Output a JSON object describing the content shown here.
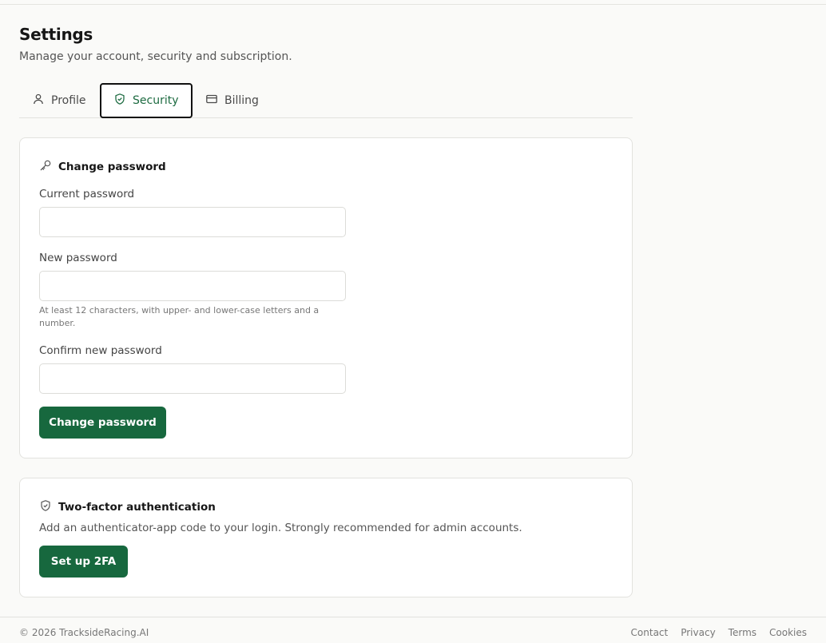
{
  "header": {
    "title": "Settings",
    "subtitle": "Manage your account, security and subscription."
  },
  "tabs": [
    {
      "label": "Profile",
      "icon": "user-icon",
      "active": false
    },
    {
      "label": "Security",
      "icon": "shield-icon",
      "active": true
    },
    {
      "label": "Billing",
      "icon": "credit-card-icon",
      "active": false
    }
  ],
  "change_password": {
    "heading": "Change password",
    "icon": "key-icon",
    "current_label": "Current password",
    "current_value": "",
    "new_label": "New password",
    "new_value": "",
    "new_help": "At least 12 characters, with upper- and lower-case letters and a number.",
    "confirm_label": "Confirm new password",
    "confirm_value": "",
    "button": "Change password"
  },
  "two_factor": {
    "heading": "Two-factor authentication",
    "icon": "shield-icon",
    "description": "Add an authenticator-app code to your login. Strongly recommended for admin accounts.",
    "button": "Set up 2FA"
  },
  "footer": {
    "copyright": "© 2026 TracksideRacing.AI",
    "links": [
      "Contact",
      "Privacy",
      "Terms",
      "Cookies"
    ]
  },
  "colors": {
    "accent": "#17683e",
    "active_tab_text": "#1d6b41",
    "background": "#fafaf8"
  }
}
